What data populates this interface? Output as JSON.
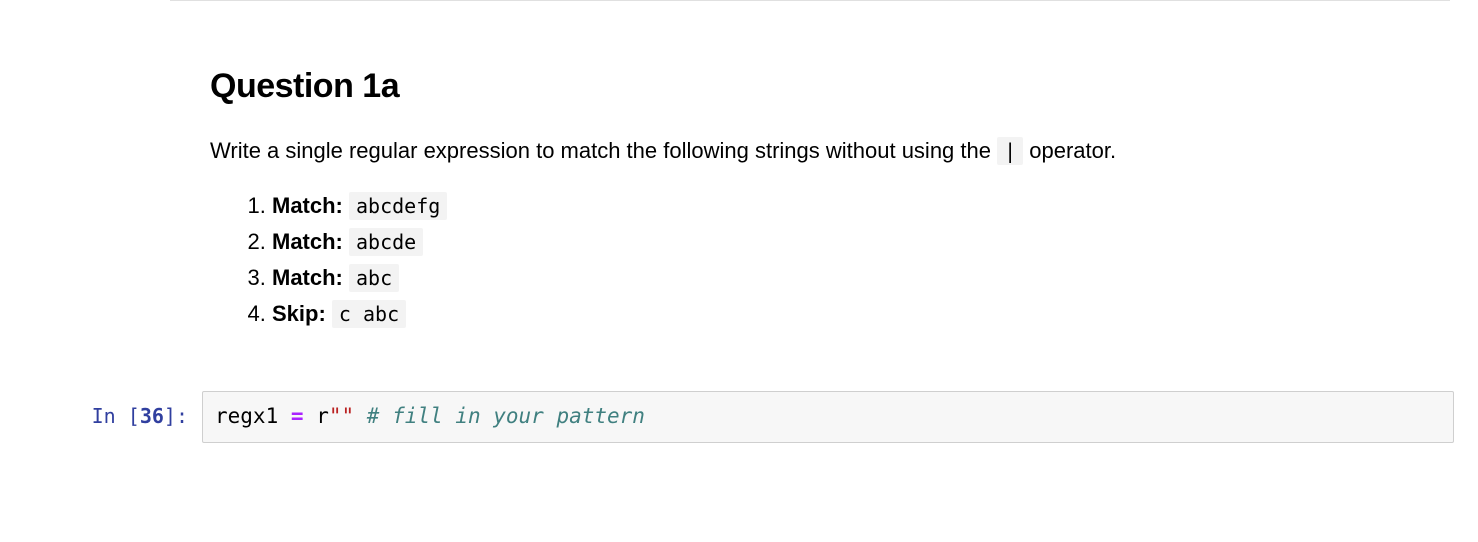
{
  "heading": "Question 1a",
  "description_parts": {
    "prefix": "Write a single regular expression to match the following strings without using the ",
    "operator": "|",
    "suffix": " operator."
  },
  "items": [
    {
      "label": "Match:",
      "value": "abcdefg"
    },
    {
      "label": "Match:",
      "value": "abcde"
    },
    {
      "label": "Match:",
      "value": "abc"
    },
    {
      "label": "Skip:",
      "value": "c abc"
    }
  ],
  "code_cell": {
    "prompt_prefix": "In [",
    "prompt_number": "36",
    "prompt_suffix": "]:",
    "var_name": "regx1",
    "assign_op": "=",
    "string_prefix": "r",
    "string_literal": "\"\"",
    "comment": "# fill in your pattern"
  }
}
